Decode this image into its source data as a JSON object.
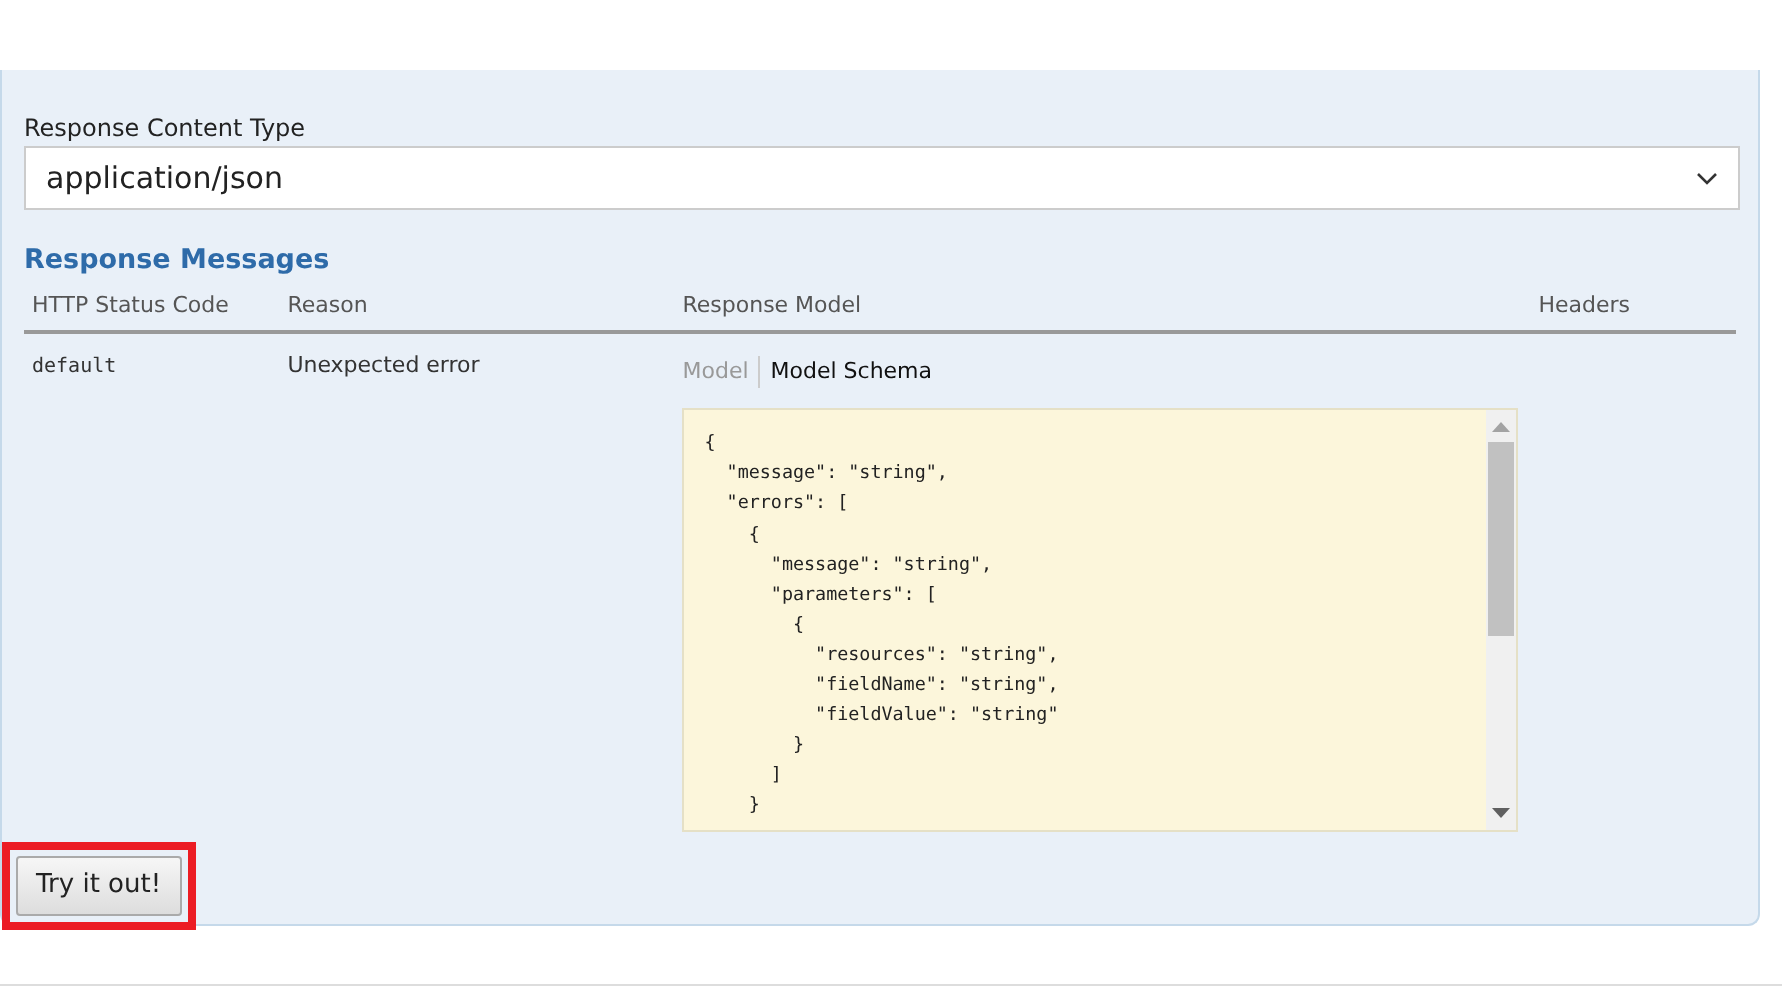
{
  "content_type": {
    "label": "Response Content Type",
    "value": "application/json"
  },
  "response_messages": {
    "title": "Response Messages",
    "columns": [
      "HTTP Status Code",
      "Reason",
      "Response Model",
      "Headers"
    ],
    "rows": [
      {
        "status_code": "default",
        "reason": "Unexpected error",
        "model_tabs": [
          {
            "label": "Model",
            "selected": false
          },
          {
            "label": "Model Schema",
            "selected": true
          }
        ],
        "schema_lines": [
          "{",
          "  \"message\": \"string\",",
          "  \"errors\": [",
          "    {",
          "      \"message\": \"string\",",
          "      \"parameters\": [",
          "        {",
          "          \"resources\": \"string\",",
          "          \"fieldName\": \"string\",",
          "          \"fieldValue\": \"string\"",
          "        }",
          "      ]",
          "    }"
        ]
      }
    ]
  },
  "try_button": {
    "label": "Try it out!",
    "highlighted": true
  }
}
